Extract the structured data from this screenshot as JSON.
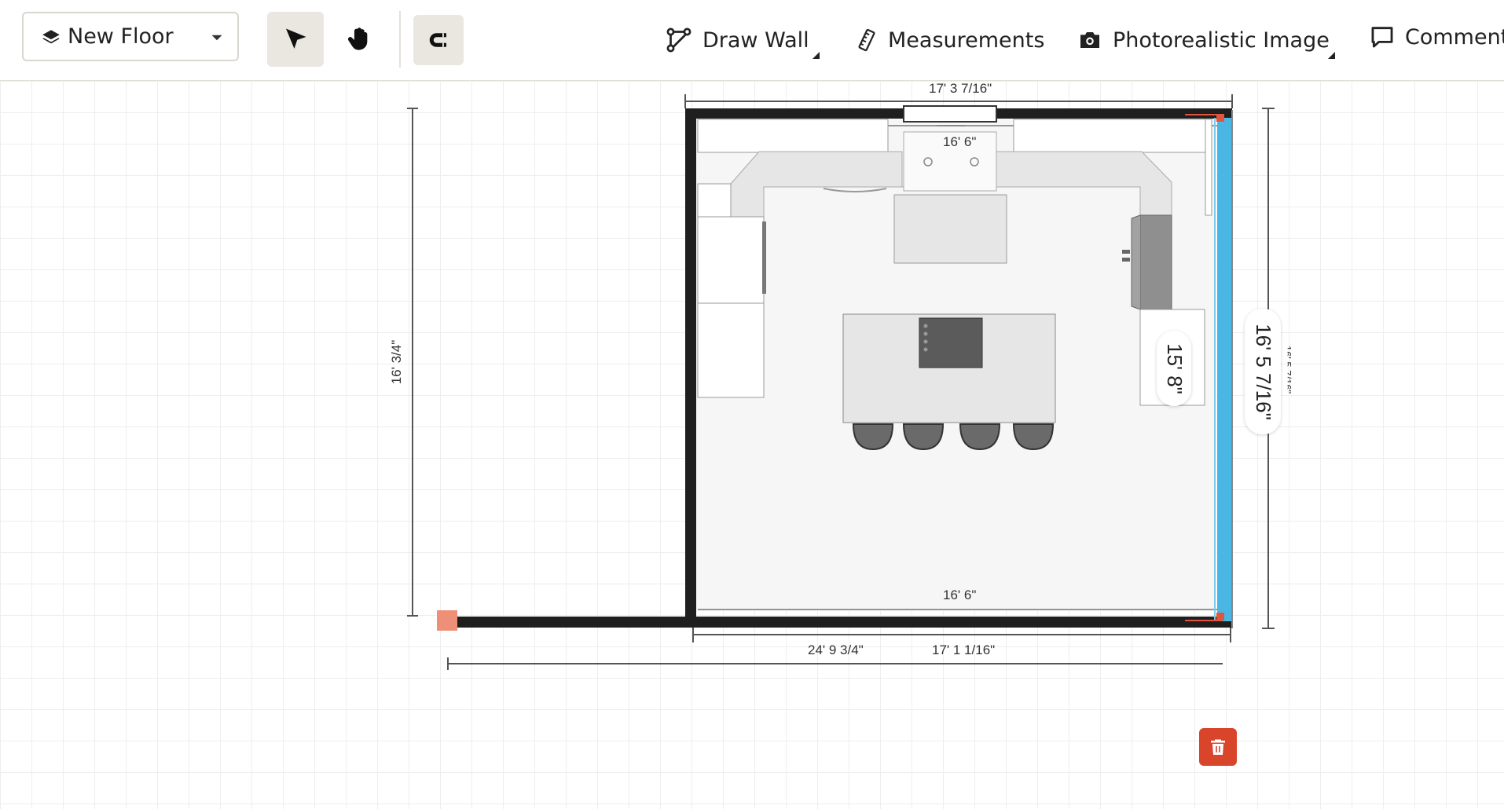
{
  "toolbar": {
    "floor_label": "New Floor",
    "actions": {
      "draw_wall": "Draw Wall",
      "measurements": "Measurements",
      "photo": "Photorealistic Image",
      "comment": "Comment"
    }
  },
  "canvas": {
    "dimensions": {
      "top_outer": "17' 3 7/16\"",
      "top_inner": "16' 6\"",
      "left_height": "16' 3/4\"",
      "bottom_inner": "16' 6\"",
      "bottom_length_left": "24' 9 3/4\"",
      "bottom_length_right": "17' 1 1/16\"",
      "right_inner_pill": "15' 8\"",
      "right_wall_pill": "16' 5 7/16\"",
      "right_outer_partial": "16' 5 7/16\""
    }
  },
  "colors": {
    "wall": "#1f1f1f",
    "selected_wall": "#4ab6e4",
    "accent_red": "#d8452b",
    "handle": "#ee8f77",
    "floor_fill": "#f7f7f7"
  }
}
